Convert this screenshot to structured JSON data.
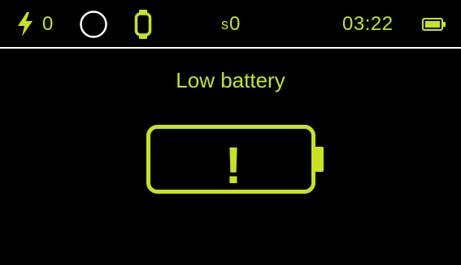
{
  "status_bar": {
    "charge_icon": "lightning-bolt-icon",
    "charge_count": "0",
    "activity_icon": "ring-icon",
    "device_icon": "watch-icon",
    "steps_prefix": "s",
    "steps_count": "0",
    "time": "03:22",
    "battery_icon": "battery-full-icon"
  },
  "main": {
    "title": "Low battery",
    "alert_icon": "low-battery-alert-icon",
    "alert_glyph": "!"
  },
  "colors": {
    "accent": "#c8e21e",
    "background": "#000000",
    "divider": "#ffffff"
  }
}
